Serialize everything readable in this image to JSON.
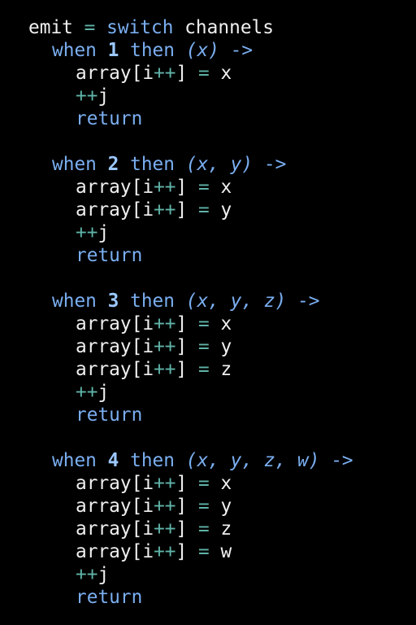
{
  "colors": {
    "background": "#000000",
    "default": "#f0f0f0",
    "keyword": "#7aaef0",
    "number": "#9cc8ff",
    "param": "#7aaef0",
    "operator": "#5fb3a8"
  },
  "code": {
    "lines": [
      {
        "indent": 0,
        "tokens": [
          {
            "t": "emit",
            "c": "default"
          },
          {
            "t": " ",
            "c": "default"
          },
          {
            "t": "=",
            "c": "operator"
          },
          {
            "t": " ",
            "c": "default"
          },
          {
            "t": "switch",
            "c": "keyword"
          },
          {
            "t": " ",
            "c": "default"
          },
          {
            "t": "channels",
            "c": "default"
          }
        ]
      },
      {
        "indent": 1,
        "tokens": [
          {
            "t": "when",
            "c": "keyword"
          },
          {
            "t": " ",
            "c": "default"
          },
          {
            "t": "1",
            "c": "number"
          },
          {
            "t": " ",
            "c": "default"
          },
          {
            "t": "then",
            "c": "keyword"
          },
          {
            "t": " ",
            "c": "default"
          },
          {
            "t": "(x)",
            "c": "param"
          },
          {
            "t": " ",
            "c": "default"
          },
          {
            "t": "->",
            "c": "keyword"
          }
        ]
      },
      {
        "indent": 2,
        "tokens": [
          {
            "t": "array[i",
            "c": "default"
          },
          {
            "t": "++",
            "c": "operator"
          },
          {
            "t": "]",
            "c": "default"
          },
          {
            "t": " ",
            "c": "default"
          },
          {
            "t": "=",
            "c": "operator"
          },
          {
            "t": " ",
            "c": "default"
          },
          {
            "t": "x",
            "c": "default"
          }
        ]
      },
      {
        "indent": 2,
        "tokens": [
          {
            "t": "++",
            "c": "operator"
          },
          {
            "t": "j",
            "c": "default"
          }
        ]
      },
      {
        "indent": 2,
        "tokens": [
          {
            "t": "return",
            "c": "keyword"
          }
        ]
      },
      {
        "indent": 0,
        "tokens": []
      },
      {
        "indent": 1,
        "tokens": [
          {
            "t": "when",
            "c": "keyword"
          },
          {
            "t": " ",
            "c": "default"
          },
          {
            "t": "2",
            "c": "number"
          },
          {
            "t": " ",
            "c": "default"
          },
          {
            "t": "then",
            "c": "keyword"
          },
          {
            "t": " ",
            "c": "default"
          },
          {
            "t": "(x, y)",
            "c": "param"
          },
          {
            "t": " ",
            "c": "default"
          },
          {
            "t": "->",
            "c": "keyword"
          }
        ]
      },
      {
        "indent": 2,
        "tokens": [
          {
            "t": "array[i",
            "c": "default"
          },
          {
            "t": "++",
            "c": "operator"
          },
          {
            "t": "]",
            "c": "default"
          },
          {
            "t": " ",
            "c": "default"
          },
          {
            "t": "=",
            "c": "operator"
          },
          {
            "t": " ",
            "c": "default"
          },
          {
            "t": "x",
            "c": "default"
          }
        ]
      },
      {
        "indent": 2,
        "tokens": [
          {
            "t": "array[i",
            "c": "default"
          },
          {
            "t": "++",
            "c": "operator"
          },
          {
            "t": "]",
            "c": "default"
          },
          {
            "t": " ",
            "c": "default"
          },
          {
            "t": "=",
            "c": "operator"
          },
          {
            "t": " ",
            "c": "default"
          },
          {
            "t": "y",
            "c": "default"
          }
        ]
      },
      {
        "indent": 2,
        "tokens": [
          {
            "t": "++",
            "c": "operator"
          },
          {
            "t": "j",
            "c": "default"
          }
        ]
      },
      {
        "indent": 2,
        "tokens": [
          {
            "t": "return",
            "c": "keyword"
          }
        ]
      },
      {
        "indent": 0,
        "tokens": []
      },
      {
        "indent": 1,
        "tokens": [
          {
            "t": "when",
            "c": "keyword"
          },
          {
            "t": " ",
            "c": "default"
          },
          {
            "t": "3",
            "c": "number"
          },
          {
            "t": " ",
            "c": "default"
          },
          {
            "t": "then",
            "c": "keyword"
          },
          {
            "t": " ",
            "c": "default"
          },
          {
            "t": "(x, y, z)",
            "c": "param"
          },
          {
            "t": " ",
            "c": "default"
          },
          {
            "t": "->",
            "c": "keyword"
          }
        ]
      },
      {
        "indent": 2,
        "tokens": [
          {
            "t": "array[i",
            "c": "default"
          },
          {
            "t": "++",
            "c": "operator"
          },
          {
            "t": "]",
            "c": "default"
          },
          {
            "t": " ",
            "c": "default"
          },
          {
            "t": "=",
            "c": "operator"
          },
          {
            "t": " ",
            "c": "default"
          },
          {
            "t": "x",
            "c": "default"
          }
        ]
      },
      {
        "indent": 2,
        "tokens": [
          {
            "t": "array[i",
            "c": "default"
          },
          {
            "t": "++",
            "c": "operator"
          },
          {
            "t": "]",
            "c": "default"
          },
          {
            "t": " ",
            "c": "default"
          },
          {
            "t": "=",
            "c": "operator"
          },
          {
            "t": " ",
            "c": "default"
          },
          {
            "t": "y",
            "c": "default"
          }
        ]
      },
      {
        "indent": 2,
        "tokens": [
          {
            "t": "array[i",
            "c": "default"
          },
          {
            "t": "++",
            "c": "operator"
          },
          {
            "t": "]",
            "c": "default"
          },
          {
            "t": " ",
            "c": "default"
          },
          {
            "t": "=",
            "c": "operator"
          },
          {
            "t": " ",
            "c": "default"
          },
          {
            "t": "z",
            "c": "default"
          }
        ]
      },
      {
        "indent": 2,
        "tokens": [
          {
            "t": "++",
            "c": "operator"
          },
          {
            "t": "j",
            "c": "default"
          }
        ]
      },
      {
        "indent": 2,
        "tokens": [
          {
            "t": "return",
            "c": "keyword"
          }
        ]
      },
      {
        "indent": 0,
        "tokens": []
      },
      {
        "indent": 1,
        "tokens": [
          {
            "t": "when",
            "c": "keyword"
          },
          {
            "t": " ",
            "c": "default"
          },
          {
            "t": "4",
            "c": "number"
          },
          {
            "t": " ",
            "c": "default"
          },
          {
            "t": "then",
            "c": "keyword"
          },
          {
            "t": " ",
            "c": "default"
          },
          {
            "t": "(x, y, z, w)",
            "c": "param"
          },
          {
            "t": " ",
            "c": "default"
          },
          {
            "t": "->",
            "c": "keyword"
          }
        ]
      },
      {
        "indent": 2,
        "tokens": [
          {
            "t": "array[i",
            "c": "default"
          },
          {
            "t": "++",
            "c": "operator"
          },
          {
            "t": "]",
            "c": "default"
          },
          {
            "t": " ",
            "c": "default"
          },
          {
            "t": "=",
            "c": "operator"
          },
          {
            "t": " ",
            "c": "default"
          },
          {
            "t": "x",
            "c": "default"
          }
        ]
      },
      {
        "indent": 2,
        "tokens": [
          {
            "t": "array[i",
            "c": "default"
          },
          {
            "t": "++",
            "c": "operator"
          },
          {
            "t": "]",
            "c": "default"
          },
          {
            "t": " ",
            "c": "default"
          },
          {
            "t": "=",
            "c": "operator"
          },
          {
            "t": " ",
            "c": "default"
          },
          {
            "t": "y",
            "c": "default"
          }
        ]
      },
      {
        "indent": 2,
        "tokens": [
          {
            "t": "array[i",
            "c": "default"
          },
          {
            "t": "++",
            "c": "operator"
          },
          {
            "t": "]",
            "c": "default"
          },
          {
            "t": " ",
            "c": "default"
          },
          {
            "t": "=",
            "c": "operator"
          },
          {
            "t": " ",
            "c": "default"
          },
          {
            "t": "z",
            "c": "default"
          }
        ]
      },
      {
        "indent": 2,
        "tokens": [
          {
            "t": "array[i",
            "c": "default"
          },
          {
            "t": "++",
            "c": "operator"
          },
          {
            "t": "]",
            "c": "default"
          },
          {
            "t": " ",
            "c": "default"
          },
          {
            "t": "=",
            "c": "operator"
          },
          {
            "t": " ",
            "c": "default"
          },
          {
            "t": "w",
            "c": "default"
          }
        ]
      },
      {
        "indent": 2,
        "tokens": [
          {
            "t": "++",
            "c": "operator"
          },
          {
            "t": "j",
            "c": "default"
          }
        ]
      },
      {
        "indent": 2,
        "tokens": [
          {
            "t": "return",
            "c": "keyword"
          }
        ]
      }
    ]
  }
}
